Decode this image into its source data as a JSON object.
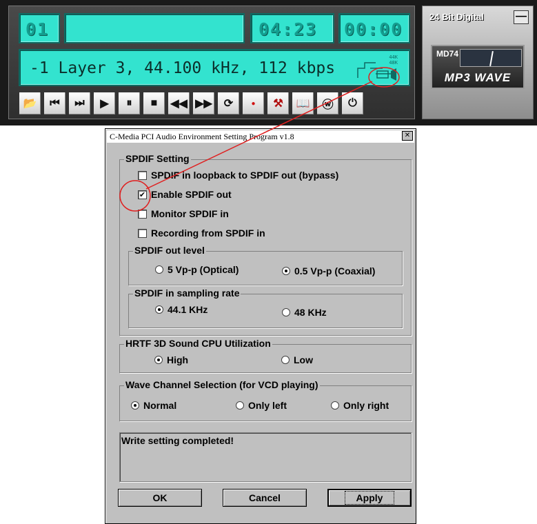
{
  "player": {
    "track": "01",
    "title": "",
    "elapsed": "04:23",
    "remaining": "00:00",
    "info": "-1 Layer 3, 44.100 kHz, 112 kbps",
    "speaker_rates": [
      "44K",
      "48K"
    ],
    "brand_label": "24 Bit Digital",
    "minimize_glyph": "—",
    "logo_md": "MD74",
    "logo_text": "MP3 WAVE",
    "buttons": [
      {
        "name": "open-folder-icon",
        "glyph": "📂"
      },
      {
        "name": "previous-track-icon",
        "glyph": "⏮"
      },
      {
        "name": "next-track-icon",
        "glyph": "⏭"
      },
      {
        "name": "play-icon",
        "glyph": "▶"
      },
      {
        "name": "pause-icon",
        "glyph": "⏸"
      },
      {
        "name": "stop-icon",
        "glyph": "■"
      },
      {
        "name": "rewind-icon",
        "glyph": "◀◀"
      },
      {
        "name": "fast-forward-icon",
        "glyph": "▶▶"
      },
      {
        "name": "repeat-icon",
        "glyph": "⟳"
      },
      {
        "name": "record-icon",
        "glyph": "●"
      },
      {
        "name": "settings-hammer-icon",
        "glyph": "⚒"
      },
      {
        "name": "playlist-book-icon",
        "glyph": "📖"
      },
      {
        "name": "waveform-icon",
        "glyph": "ⓦ"
      },
      {
        "name": "power-icon",
        "glyph": "⏻"
      }
    ]
  },
  "dialog": {
    "title": "C-Media PCI Audio Environment Setting Program v1.8",
    "close_glyph": "✕",
    "spdif": {
      "label": "SPDIF Setting",
      "options": [
        {
          "label": "SPDIF in loopback to SPDIF out (bypass)",
          "checked": false
        },
        {
          "label": "Enable SPDIF out",
          "checked": true
        },
        {
          "label": "Monitor SPDIF in",
          "checked": false
        },
        {
          "label": "Recording from SPDIF in",
          "checked": false
        }
      ],
      "out_level": {
        "label": "SPDIF out level",
        "options": [
          {
            "label": "5 Vp-p (Optical)",
            "selected": false
          },
          {
            "label": "0.5 Vp-p (Coaxial)",
            "selected": true
          }
        ]
      },
      "sampling": {
        "label": "SPDIF in sampling rate",
        "options": [
          {
            "label": "44.1 KHz",
            "selected": true
          },
          {
            "label": "48 KHz",
            "selected": false
          }
        ]
      }
    },
    "hrtf": {
      "label": "HRTF 3D Sound CPU Utilization",
      "options": [
        {
          "label": "High",
          "selected": true
        },
        {
          "label": "Low",
          "selected": false
        }
      ]
    },
    "wave": {
      "label": "Wave Channel Selection (for VCD playing)",
      "options": [
        {
          "label": "Normal",
          "selected": true
        },
        {
          "label": "Only left",
          "selected": false
        },
        {
          "label": "Only right",
          "selected": false
        }
      ]
    },
    "status_text": "Write setting completed!",
    "buttons": {
      "ok": "OK",
      "cancel": "Cancel",
      "apply": "Apply"
    }
  },
  "colors": {
    "lcd": "#33e3cf",
    "annotation": "#e02020",
    "dialog_face": "#c0c0c0"
  }
}
